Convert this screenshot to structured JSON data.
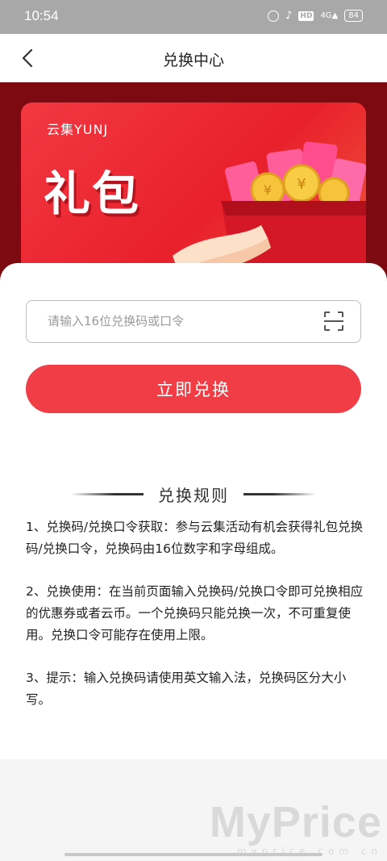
{
  "status_bar": {
    "time": "10:54",
    "network": "4G",
    "hd": "HD",
    "battery": "84",
    "icons": [
      "alarm-icon",
      "bell-muted-icon",
      "hd-icon",
      "signal-icon",
      "battery-icon"
    ]
  },
  "navbar": {
    "back_icon": "chevron-left-icon",
    "title": "兑换中心"
  },
  "banner": {
    "brand": "云集YUNJ",
    "title": "礼包",
    "art": "gift-box-with-red-envelopes-and-coins"
  },
  "redeem": {
    "placeholder": "请输入16位兑换码或口令",
    "value": "",
    "scan_icon": "scan-icon",
    "button_label": "立即兑换"
  },
  "rules": {
    "title": "兑换规则",
    "items": [
      "1、兑换码/兑换口令获取：参与云集活动有机会获得礼包兑换码/兑换口令，兑换码由16位数字和字母组成。",
      "2、兑换使用：在当前页面输入兑换码/兑换口令即可兑换相应的优惠券或者云币。一个兑换码只能兑换一次，不可重复使用。兑换口令可能存在使用上限。",
      "3、提示：输入兑换码请使用英文输入法，兑换码区分大小写。"
    ]
  },
  "watermark": {
    "main": "MyPrice",
    "sub": "myprice.com.cn"
  },
  "colors": {
    "primary": "#f13e46",
    "banner_bg": "#7c0a10",
    "status_bar": "#a8a8a8"
  }
}
